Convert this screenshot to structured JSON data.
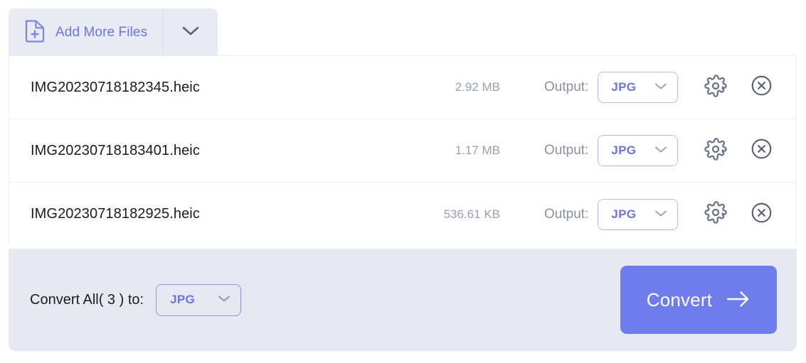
{
  "toolbar": {
    "add_files_label": "Add More Files",
    "add_file_icon": "file-plus-icon",
    "caret_icon": "chevron-down-icon"
  },
  "file_list": {
    "output_label": "Output:",
    "settings_icon": "gear-icon",
    "remove_icon": "close-circle-icon",
    "select_caret_icon": "chevron-down-icon",
    "rows": [
      {
        "name": "IMG20230718182345.heic",
        "size": "2.92 MB",
        "output_format": "JPG"
      },
      {
        "name": "IMG20230718183401.heic",
        "size": "1.17 MB",
        "output_format": "JPG"
      },
      {
        "name": "IMG20230718182925.heic",
        "size": "536.61 KB",
        "output_format": "JPG"
      }
    ]
  },
  "footer": {
    "convert_all_label": "Convert All( 3 ) to:",
    "convert_all_format": "JPG",
    "convert_button_label": "Convert",
    "convert_button_icon": "arrow-right-icon",
    "select_caret_icon": "chevron-down-icon"
  },
  "colors": {
    "accent": "#6c74e0",
    "button": "#6f7ceb",
    "footer_bg": "#e6e9f2",
    "tab_bg": "#e9ebf4",
    "muted_text": "#9aa0b0",
    "icon_gray": "#6b7287"
  }
}
